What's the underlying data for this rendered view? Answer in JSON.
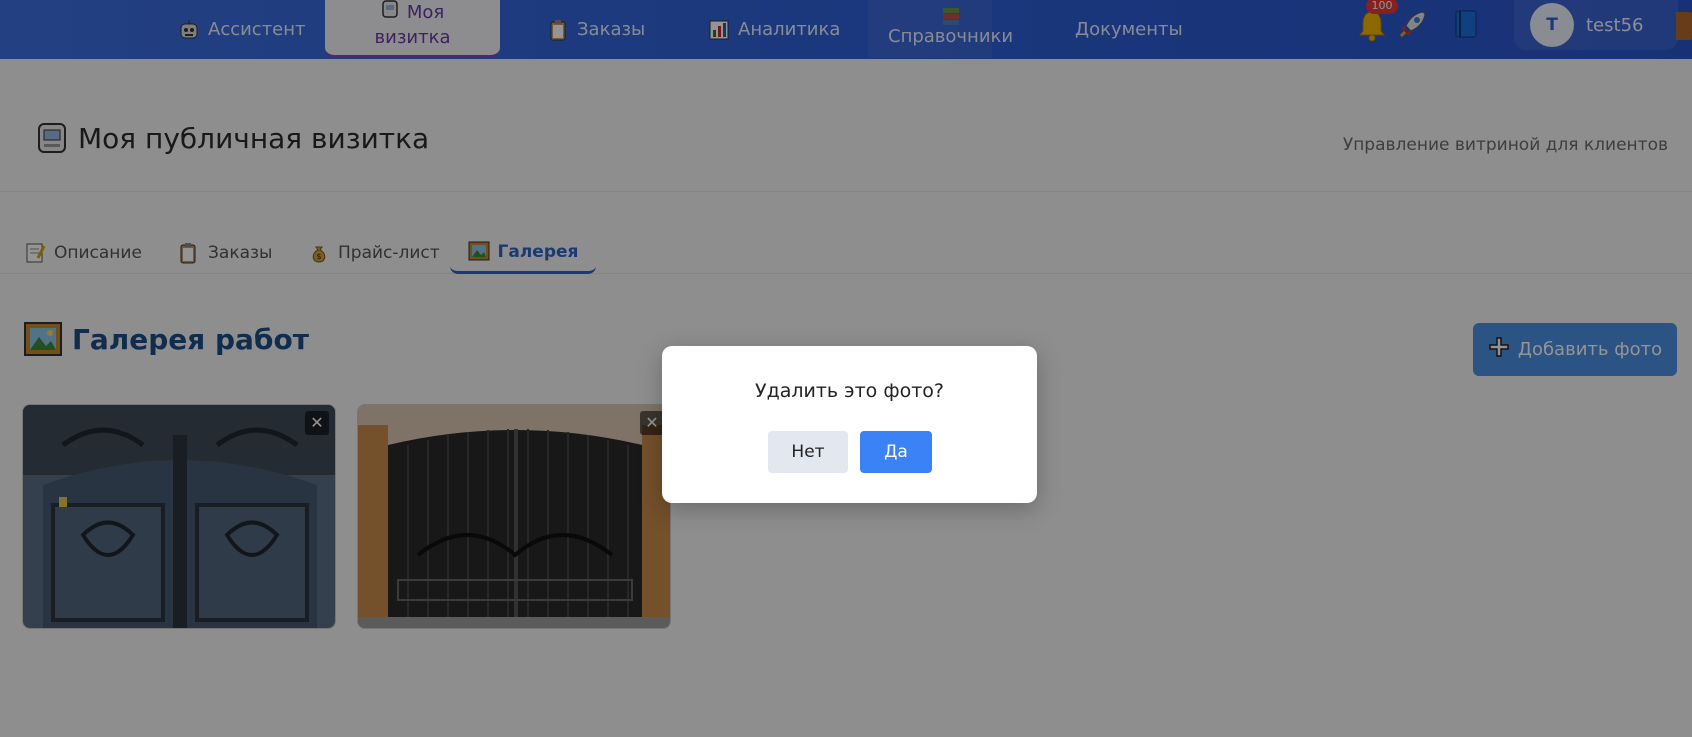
{
  "nav": {
    "items": [
      {
        "label": "Ассистент",
        "icon": "robot-icon"
      },
      {
        "label": "Моя визитка",
        "line1": "Моя",
        "line2": "визитка",
        "icon": "card-icon",
        "active": true
      },
      {
        "label": "Заказы",
        "icon": "clipboard-icon"
      },
      {
        "label": "Аналитика",
        "icon": "chart-icon"
      },
      {
        "label": "Справочники",
        "icon": "books-icon"
      },
      {
        "label": "Документы"
      }
    ],
    "notifications_count": "100",
    "user": {
      "initial": "T",
      "name": "test56"
    }
  },
  "page": {
    "title": "Моя публичная визитка",
    "subtitle": "Управление витриной для клиентов"
  },
  "tabs": [
    {
      "label": "Описание",
      "icon": "memo-icon"
    },
    {
      "label": "Заказы",
      "icon": "clipboard-icon"
    },
    {
      "label": "Прайс-лист",
      "icon": "money-bag-icon"
    },
    {
      "label": "Галерея",
      "icon": "picture-icon",
      "active": true
    }
  ],
  "gallery": {
    "title": "Галерея работ",
    "add_button": "Добавить фото",
    "photos": [
      {
        "description": "ornate forged gate",
        "close": "✕"
      },
      {
        "description": "forged gate with brick pillars",
        "close": "✕"
      }
    ]
  },
  "dialog": {
    "question": "Удалить это фото?",
    "no": "Нет",
    "yes": "Да"
  },
  "colors": {
    "nav_bg": "#2f60d8",
    "accent": "#2f63c8",
    "primary_button": "#3b82f6",
    "gallery_title": "#1e4f86"
  }
}
